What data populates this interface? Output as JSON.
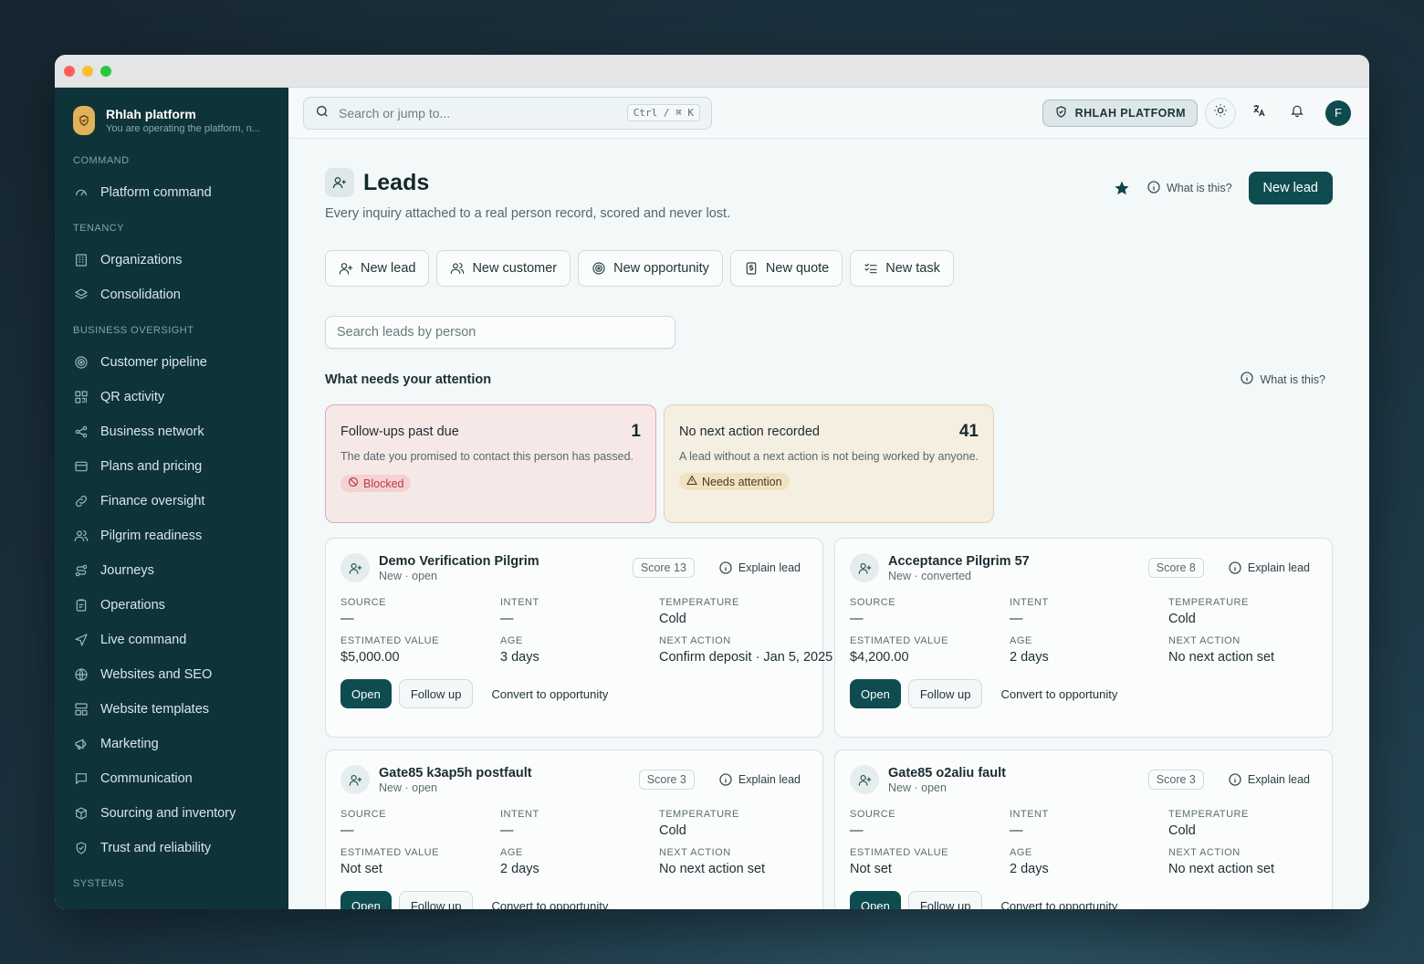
{
  "sidebar": {
    "brand_title": "Rhlah platform",
    "brand_subtitle": "You are operating the platform, n...",
    "sections": [
      {
        "title": "COMMAND",
        "items": [
          {
            "label": "Platform command",
            "icon": "gauge-icon"
          }
        ]
      },
      {
        "title": "TENANCY",
        "items": [
          {
            "label": "Organizations",
            "icon": "building-icon"
          },
          {
            "label": "Consolidation",
            "icon": "layers-icon"
          }
        ]
      },
      {
        "title": "BUSINESS OVERSIGHT",
        "items": [
          {
            "label": "Customer pipeline",
            "icon": "target-icon"
          },
          {
            "label": "QR activity",
            "icon": "qr-icon"
          },
          {
            "label": "Business network",
            "icon": "share-icon"
          },
          {
            "label": "Plans and pricing",
            "icon": "card-icon"
          },
          {
            "label": "Finance oversight",
            "icon": "link-icon"
          },
          {
            "label": "Pilgrim readiness",
            "icon": "users-icon"
          },
          {
            "label": "Journeys",
            "icon": "route-icon"
          },
          {
            "label": "Operations",
            "icon": "clipboard-icon"
          },
          {
            "label": "Live command",
            "icon": "navigation-icon"
          },
          {
            "label": "Websites and SEO",
            "icon": "globe-icon"
          },
          {
            "label": "Website templates",
            "icon": "template-icon"
          },
          {
            "label": "Marketing",
            "icon": "megaphone-icon"
          },
          {
            "label": "Communication",
            "icon": "message-icon"
          },
          {
            "label": "Sourcing and inventory",
            "icon": "package-icon"
          },
          {
            "label": "Trust and reliability",
            "icon": "shield-icon"
          }
        ]
      },
      {
        "title": "SYSTEMS",
        "items": []
      }
    ]
  },
  "topbar": {
    "search_placeholder": "Search or jump to...",
    "shortcut": "Ctrl / ⌘ K",
    "platform_label": "RHLAH PLATFORM",
    "avatar_initial": "F"
  },
  "page": {
    "title": "Leads",
    "subtitle": "Every inquiry attached to a real person record, scored and never lost.",
    "what_is_this": "What is this?",
    "new_lead_button": "New lead"
  },
  "quick_actions": [
    {
      "label": "New lead",
      "icon": "user-plus-icon"
    },
    {
      "label": "New customer",
      "icon": "users-icon"
    },
    {
      "label": "New opportunity",
      "icon": "target-icon"
    },
    {
      "label": "New quote",
      "icon": "dollar-doc-icon"
    },
    {
      "label": "New task",
      "icon": "checklist-icon"
    }
  ],
  "lead_search_placeholder": "Search leads by person",
  "attention": {
    "title": "What needs your attention",
    "what_is_this": "What is this?",
    "alerts": [
      {
        "title": "Follow-ups past due",
        "count": "1",
        "description": "The date you promised to contact this person has passed.",
        "badge": "Blocked"
      },
      {
        "title": "No next action recorded",
        "count": "41",
        "description": "A lead without a next action is not being worked by anyone.",
        "badge": "Needs attention"
      }
    ]
  },
  "field_labels": {
    "source": "SOURCE",
    "intent": "INTENT",
    "temperature": "TEMPERATURE",
    "estimated_value": "ESTIMATED VALUE",
    "age": "AGE",
    "next_action": "NEXT ACTION"
  },
  "card_actions": {
    "open": "Open",
    "follow_up": "Follow up",
    "convert": "Convert to opportunity",
    "explain": "Explain lead"
  },
  "leads": [
    {
      "name": "Demo Verification Pilgrim",
      "status": "New · open",
      "score": "Score 13",
      "source": "—",
      "intent": "—",
      "temperature": "Cold",
      "estimated_value": "$5,000.00",
      "age": "3 days",
      "next_action": "Confirm deposit · Jan 5, 2025"
    },
    {
      "name": "Acceptance Pilgrim 57",
      "status": "New · converted",
      "score": "Score 8",
      "source": "—",
      "intent": "—",
      "temperature": "Cold",
      "estimated_value": "$4,200.00",
      "age": "2 days",
      "next_action": "No next action set"
    },
    {
      "name": "Gate85 k3ap5h postfault",
      "status": "New · open",
      "score": "Score 3",
      "source": "—",
      "intent": "—",
      "temperature": "Cold",
      "estimated_value": "Not set",
      "age": "2 days",
      "next_action": "No next action set"
    },
    {
      "name": "Gate85 o2aliu fault",
      "status": "New · open",
      "score": "Score 3",
      "source": "—",
      "intent": "—",
      "temperature": "Cold",
      "estimated_value": "Not set",
      "age": "2 days",
      "next_action": "No next action set"
    }
  ]
}
